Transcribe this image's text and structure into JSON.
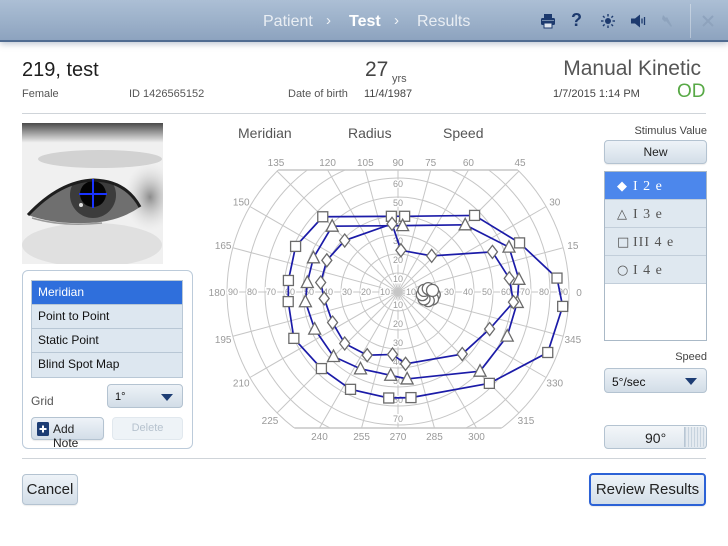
{
  "nav": {
    "steps": [
      {
        "label": "Patient",
        "state": "done"
      },
      {
        "label": "Test",
        "state": "current"
      },
      {
        "label": "Results",
        "state": "upcoming"
      }
    ],
    "separator": "›",
    "icons": [
      "printer",
      "help",
      "brightness",
      "volume",
      "settings",
      "close"
    ],
    "help_glyph": "?"
  },
  "patient": {
    "name": "219, test",
    "sex": "Female",
    "id_text": "ID 1426565152",
    "dob_label": "Date of birth",
    "dob": "11/4/1987",
    "age": "27",
    "age_unit": "yrs"
  },
  "test": {
    "type": "Manual Kinetic",
    "datetime": "1/7/2015 1:14 PM",
    "eye": "OD"
  },
  "colors": {
    "accent": "#2f6fdc",
    "stimulus_selected": "#4c87ec",
    "eye_label": "#58a946",
    "isopter_line": "#1b1ba8",
    "primary_button_border": "#2c62d6",
    "topbar": "#9bb0c9"
  },
  "modes": {
    "items": [
      "Meridian",
      "Point to Point",
      "Static Point",
      "Blind Spot Map"
    ],
    "selected": "Meridian"
  },
  "grid": {
    "label": "Grid",
    "value": "1°"
  },
  "notes": {
    "add_label": "Add Note",
    "delete_label": "Delete"
  },
  "chart_headers": {
    "meridian": "Meridian",
    "radius": "Radius",
    "speed": "Speed"
  },
  "stimulus": {
    "title": "Stimulus Value",
    "new_label": "New",
    "items": [
      {
        "symbol": "diamond",
        "glyph": "◆",
        "label": "I 2 e"
      },
      {
        "symbol": "triangle",
        "glyph": "△",
        "label": "I 3 e"
      },
      {
        "symbol": "square",
        "glyph": "□",
        "label": "III 4 e"
      },
      {
        "symbol": "circle",
        "glyph": "○",
        "label": "I 4 e"
      }
    ],
    "selected": "I 2 e"
  },
  "speed": {
    "label": "Speed",
    "value": "5°/sec"
  },
  "meridian_input": {
    "value": "90°"
  },
  "footer": {
    "cancel_label": "Cancel",
    "review_label": "Review Results"
  },
  "chart_data": {
    "type": "line",
    "coordinate_system": "polar",
    "title": "",
    "meridian_labels": [
      0,
      15,
      30,
      45,
      60,
      75,
      90,
      105,
      120,
      135,
      150,
      165,
      180,
      195,
      210,
      225,
      240,
      255,
      270,
      285,
      300,
      315,
      330,
      345
    ],
    "eccentricity_rings": [
      10,
      20,
      30,
      40,
      50,
      60,
      70,
      80,
      90
    ],
    "eccentricity_max": 90,
    "radial_tick_labels": {
      "horizontal": [
        10,
        20,
        30,
        40,
        50,
        60,
        70,
        80,
        90
      ],
      "up": [
        10,
        20,
        30,
        40,
        50,
        60
      ],
      "down": [
        10,
        20,
        30,
        40,
        50,
        60,
        70
      ]
    },
    "grid": true,
    "series": [
      {
        "name": "III 4 e",
        "symbol": "square",
        "closed": true,
        "points": [
          [
            355,
            87
          ],
          [
            5,
            84
          ],
          [
            22,
            69
          ],
          [
            45,
            57
          ],
          [
            85,
            40
          ],
          [
            95,
            40
          ],
          [
            135,
            56
          ],
          [
            156,
            59
          ],
          [
            174,
            58
          ],
          [
            185,
            58
          ],
          [
            204,
            60
          ],
          [
            225,
            57
          ],
          [
            244,
            57
          ],
          [
            265,
            56
          ],
          [
            277,
            56
          ],
          [
            315,
            68
          ],
          [
            338,
            85
          ]
        ]
      },
      {
        "name": "I 3 e",
        "symbol": "triangle",
        "closed": true,
        "points": [
          [
            355,
            63
          ],
          [
            6,
            64
          ],
          [
            22,
            63
          ],
          [
            45,
            50
          ],
          [
            86,
            35
          ],
          [
            135,
            49
          ],
          [
            158,
            48
          ],
          [
            174,
            48
          ],
          [
            186,
            49
          ],
          [
            204,
            48
          ],
          [
            225,
            48
          ],
          [
            244,
            45
          ],
          [
            265,
            44
          ],
          [
            276,
            46
          ],
          [
            316,
            60
          ],
          [
            338,
            62
          ]
        ]
      },
      {
        "name": "I 2 e",
        "symbol": "diamond",
        "closed": true,
        "points": [
          [
            355,
            61
          ],
          [
            7,
            59
          ],
          [
            23,
            54
          ],
          [
            47,
            26
          ],
          [
            86,
            22
          ],
          [
            95,
            36
          ],
          [
            136,
            39
          ],
          [
            156,
            41
          ],
          [
            173,
            41
          ],
          [
            185,
            39
          ],
          [
            205,
            38
          ],
          [
            224,
            39
          ],
          [
            244,
            37
          ],
          [
            265,
            33
          ],
          [
            276,
            38
          ],
          [
            316,
            47
          ],
          [
            338,
            52
          ]
        ]
      }
    ],
    "blind_spot": {
      "name": "I 4 e",
      "symbol": "circle",
      "meridian": 355,
      "eccentricity": 16,
      "count": 8
    }
  }
}
